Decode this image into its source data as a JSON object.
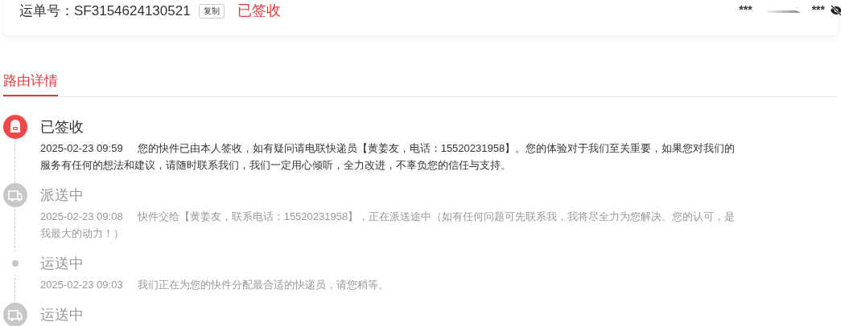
{
  "header": {
    "label": "运单号：",
    "waybill": "SF3154624130521",
    "copy_button": "复制",
    "status": "已签收",
    "origin": "***",
    "destination": "***"
  },
  "tabs": [
    {
      "label": "路由详情",
      "selected": true
    }
  ],
  "timeline": [
    {
      "kind": "signed",
      "current": true,
      "title": "已签收",
      "time": "2025-02-23 09:59",
      "text": "您的快件已由本人签收，如有疑问请电联快递员【黄姜友，电话：15520231958】。您的体验对于我们至关重要，如果您对我们的服务有任何的想法和建议，请随时联系我们，我们一定用心倾听，全力改进，不辜负您的信任与支持。"
    },
    {
      "kind": "truck",
      "current": false,
      "title": "派送中",
      "time": "2025-02-23 09:08",
      "text": "快件交给【黄姜友，联系电话：15520231958】，正在派送途中（如有任何问题可先联系我，我将尽全力为您解决。您的认可，是我最大的动力！）"
    },
    {
      "kind": "dot",
      "current": false,
      "title": "运送中",
      "time": "2025-02-23 09:03",
      "text": "我们正在为您的快件分配最合适的快递员，请您稍等。"
    },
    {
      "kind": "truck",
      "current": false,
      "title": "运送中"
    }
  ]
}
